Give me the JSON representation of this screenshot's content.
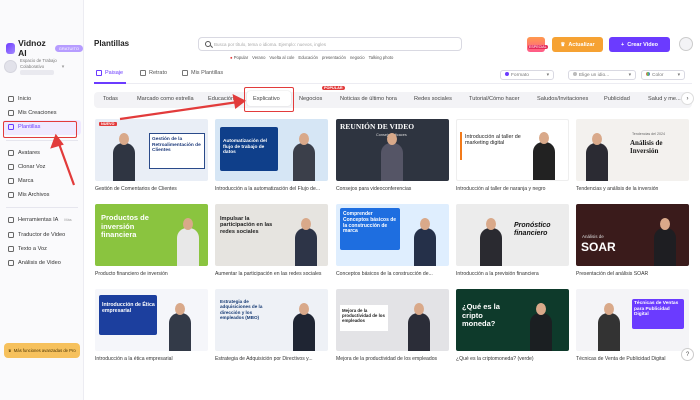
{
  "app": {
    "name": "Vidnoz AI",
    "plan_badge": "GRATUITO"
  },
  "workspace": {
    "line1": "Espacio de Trabajo",
    "line2": "Colaborativo"
  },
  "sidebar": {
    "items": [
      {
        "label": "Inicio",
        "icon": "home-icon"
      },
      {
        "label": "Mis Creaciones",
        "icon": "folder-icon"
      },
      {
        "label": "Plantillas",
        "icon": "template-icon",
        "active": true
      },
      {
        "label": "Avatares",
        "icon": "avatar-icon"
      },
      {
        "label": "Clonar Voz",
        "icon": "voice-icon"
      },
      {
        "label": "Marca",
        "icon": "brand-icon"
      },
      {
        "label": "Mis Archivos",
        "icon": "files-icon"
      }
    ],
    "tools": [
      {
        "label": "Herramientas IA",
        "badge": "Más"
      },
      {
        "label": "Traductor de Video"
      },
      {
        "label": "Texto a Voz"
      },
      {
        "label": "Análisis de Video"
      }
    ],
    "upgrade_text": "Más funciones avanzadas de Pro"
  },
  "header": {
    "title": "Plantillas",
    "search_placeholder": "Busca por título, tema o idioma. Ejemplo: nuevos, ingles",
    "quick_links": [
      "Popular",
      "Verano",
      "Vuelta al cole",
      "Educación",
      "presentación",
      "negocio",
      "Talking photo"
    ],
    "gift_tag": "ESPECIAL",
    "upgrade_label": "Actualizar",
    "create_label": "Crear Video"
  },
  "orientation_tabs": [
    {
      "label": "Paisaje",
      "active": true
    },
    {
      "label": "Retrato"
    },
    {
      "label": "Mis Plantillas"
    }
  ],
  "filters": {
    "format": "Formato",
    "language": "Elige un idio...",
    "color": "Color"
  },
  "categories": [
    "Todas",
    "Marcado como estrella",
    "Educación",
    "Explicativo",
    "Negocios",
    "Noticias de último hora",
    "Redes sociales",
    "Tutorial/Cómo hacer",
    "Saludos/Invitaciones",
    "Publicidad",
    "Salud y me..."
  ],
  "active_category": "Explicativo",
  "popular_tag": "POPULAR",
  "templates": [
    {
      "caption": "Gestión de Comentarios de Clientes",
      "thumb_title": "Gestión de la Retroalimentación de Clientes",
      "tag": "NUEVO"
    },
    {
      "caption": "Introducción a la automatización del Flujo de...",
      "thumb_title": "Automatización del flujo de trabajo de datos"
    },
    {
      "caption": "Consejos para videoconferencias",
      "thumb_title": "REUNIÓN DE VIDEO",
      "thumb_sub": "Consejos eficaces"
    },
    {
      "caption": "Introducción al taller de naranja y negro",
      "thumb_title": "Introducción al taller de marketing digital"
    },
    {
      "caption": "Tendencias y análisis de la inversión",
      "thumb_title": "Análisis de Inversión",
      "thumb_sub": "Tendencias del 2024"
    },
    {
      "caption": "Producto financiero de inversión",
      "thumb_title": "Productos de inversión financiera"
    },
    {
      "caption": "Aumentar la participación en las redes sociales",
      "thumb_title": "Impulsar la participación en las redes sociales"
    },
    {
      "caption": "Conceptos básicos de la construcción de...",
      "thumb_title": "Comprender Conceptos básicos de la construcción de marca"
    },
    {
      "caption": "Introducción a la previsión financiera",
      "thumb_title": "Pronóstico financiero"
    },
    {
      "caption": "Presentación del análisis SOAR",
      "thumb_title": "SOAR",
      "thumb_sub": "Análisis de"
    },
    {
      "caption": "Introducción a la ética empresarial",
      "thumb_title": "Introducción de Ética empresarial"
    },
    {
      "caption": "Estrategia de Adquisición por Directivos y...",
      "thumb_title": "Estrategia de adquisiciones de la dirección y los empleados (MBO)"
    },
    {
      "caption": "Mejora de la productividad de los empleados",
      "thumb_title": "Mejora de la productividad de los empleados"
    },
    {
      "caption": "¿Qué es la criptomoneda? (verde)",
      "thumb_title": "¿Qué es la cripto moneda?"
    },
    {
      "caption": "Técnicas de Venta de Publicidad Digital",
      "thumb_title": "Técnicas de Ventas para Publicidad Digital"
    }
  ],
  "colors": {
    "accent": "#6b3bff",
    "upgrade": "#f6a233",
    "highlight": "#e23b3b"
  }
}
